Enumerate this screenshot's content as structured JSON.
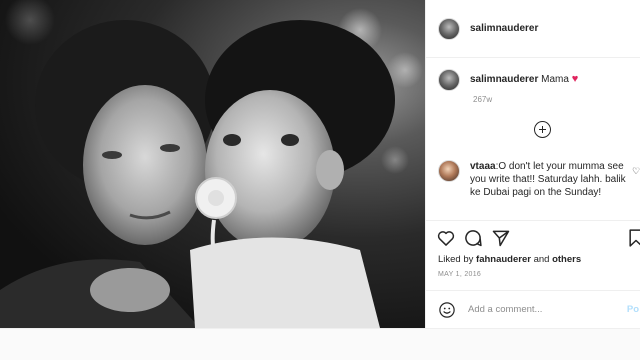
{
  "post": {
    "username": "salimnauderer",
    "caption": {
      "username": "salimnauderer",
      "text": "Mama",
      "heart": "♥",
      "time_ago": "267w"
    },
    "comment": {
      "username": "vtaaa",
      "text": ":O don't let your mumma see you write that!! Saturday lahh. balik ke Dubai pagi on the Sunday!"
    },
    "likes": {
      "prefix": "Liked by",
      "first_user": "fahnauderer",
      "and": "and",
      "others": "others"
    },
    "date": "MAY 1, 2016",
    "add_comment": {
      "placeholder": "Add a comment...",
      "post_label": "Po"
    }
  },
  "icons": {
    "like": "heart-outline-icon",
    "comment": "speech-bubble-icon",
    "share": "paper-plane-icon",
    "save": "bookmark-icon",
    "emoji": "smiley-icon",
    "load_more": "plus-circle-icon"
  },
  "colors": {
    "heart_red": "#e0245e",
    "muted": "#8e8e8e",
    "text": "#262626",
    "post_disabled": "#b2dffc"
  }
}
